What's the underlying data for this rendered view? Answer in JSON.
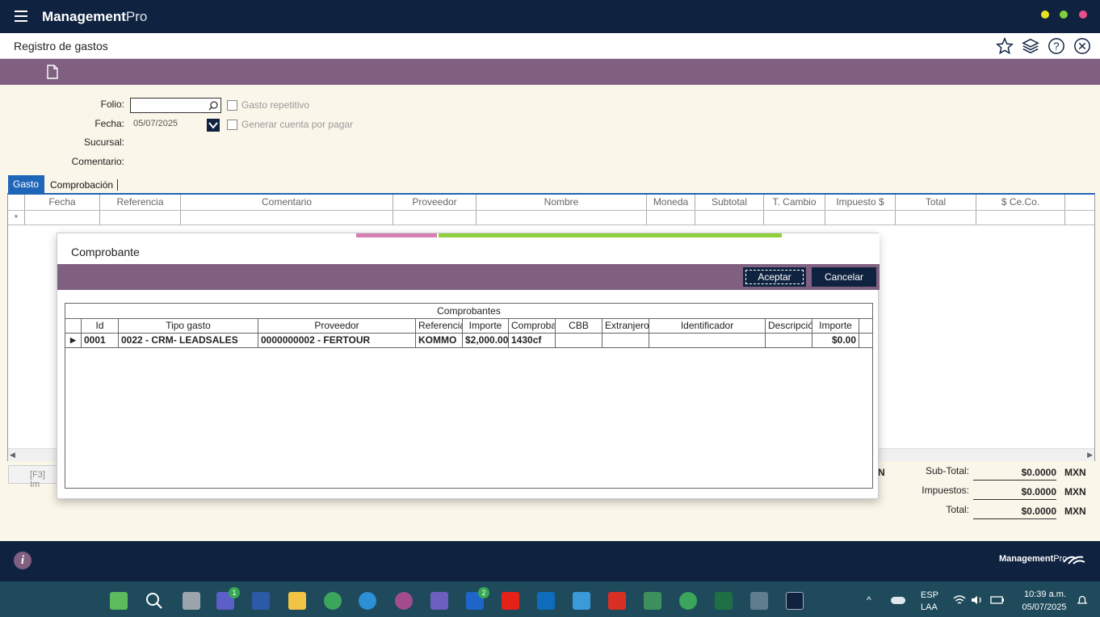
{
  "app": {
    "brand": "Management",
    "brand_suffix": "Pro"
  },
  "header": {
    "title": "Registro de gastos"
  },
  "form": {
    "folio_label": "Folio:",
    "fecha_label": "Fecha:",
    "fecha_value": "05/07/2025",
    "sucursal_label": "Sucursal:",
    "comentario_label": "Comentario:",
    "gasto_repetitivo": "Gasto repetitivo",
    "generar_cuenta": "Generar cuenta por pagar"
  },
  "tabs": [
    {
      "label": "Gasto"
    },
    {
      "label": "Comprobación"
    }
  ],
  "grid": {
    "new_row_marker": "*",
    "columns": [
      "Fecha",
      "Referencia",
      "Comentario",
      "Proveedor",
      "Nombre",
      "Moneda",
      "Subtotal",
      "T. Cambio",
      "Impuesto $",
      "Total",
      "$ Ce.Co."
    ]
  },
  "f3_label": "[F3] Im",
  "partial_mxn": "N",
  "totals": {
    "subtotal_label": "Sub-Total:",
    "subtotal_value": "$0.0000",
    "impuestos_label": "Impuestos:",
    "impuestos_value": "$0.0000",
    "total_label": "Total:",
    "total_value": "$0.0000",
    "currency": "MXN"
  },
  "modal": {
    "title": "Comprobante",
    "accept_label": "Aceptar",
    "cancel_label": "Cancelar",
    "grid_title": "Comprobantes",
    "columns": [
      "Id",
      "Tipo gasto",
      "Proveedor",
      "Referencia",
      "Importe",
      "Comprobante",
      "CBB",
      "Extranjero",
      "Identificador",
      "Descripción",
      "Importe"
    ],
    "rows": [
      {
        "id": "0001",
        "tipo_gasto": "0022 - CRM- LEADSALES",
        "proveedor": "0000000002 - FERTOUR",
        "referencia": "KOMMO",
        "importe": "$2,000.00",
        "comprobante": "1430cf",
        "cbb": "",
        "extranjero": "",
        "identificador": "",
        "descripcion": "",
        "importe2": "$0.00"
      }
    ]
  },
  "taskbar": {
    "lang": "ESP",
    "layout": "LAA",
    "time": "10:39 a.m.",
    "date": "05/07/2025",
    "teams_badge": "1",
    "l_badge": "2"
  },
  "colors": {
    "primary": "#0f2340",
    "toolbar": "#806080",
    "form_bg": "#fbf6ea",
    "tab_active": "#1f66b8"
  }
}
